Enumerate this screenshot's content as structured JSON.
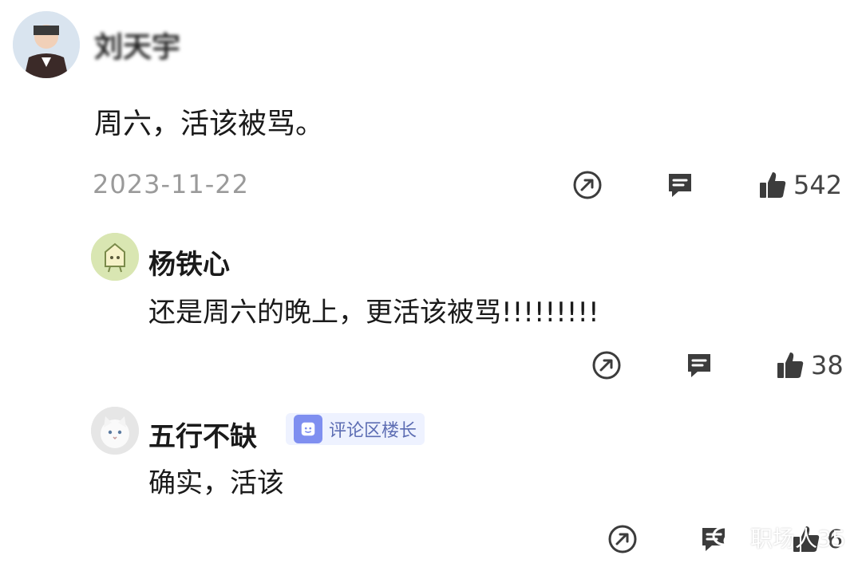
{
  "main_comment": {
    "username": "刘天宇",
    "text": "周六，活该被骂。",
    "date": "2023-11-22",
    "like_count": "542"
  },
  "replies": [
    {
      "username": "杨铁心",
      "text": "还是周六的晚上，更活该被骂!!!!!!!!!",
      "like_count": "38"
    },
    {
      "username": "五行不缺",
      "badge": "评论区楼长",
      "text": "确实，活该",
      "like_count": "6"
    }
  ],
  "watermark": {
    "text": "职场人35"
  },
  "icons": {
    "share": "share-icon",
    "comment": "comment-icon",
    "like": "thumbs-up-icon",
    "wechat": "wechat-icon"
  },
  "colors": {
    "text": "#1a1a1a",
    "meta": "#9a9a9a",
    "badge_bg": "#eef2ff",
    "badge_text": "#5d6db3"
  }
}
